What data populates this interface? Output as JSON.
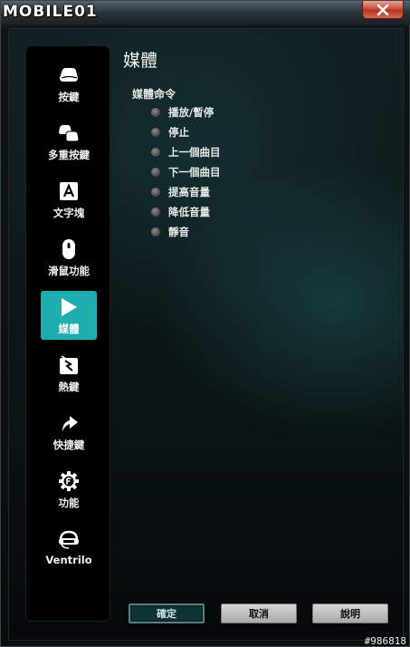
{
  "watermark": {
    "logo": "MOBILE01",
    "id": "#986818"
  },
  "window": {
    "close_symbol": "✕"
  },
  "sidebar": {
    "items": [
      {
        "label": "按鍵",
        "icon": "key-icon"
      },
      {
        "label": "多重按鍵",
        "icon": "multi-key-icon"
      },
      {
        "label": "文字塊",
        "icon": "text-block-icon"
      },
      {
        "label": "滑鼠功能",
        "icon": "mouse-icon"
      },
      {
        "label": "媒體",
        "icon": "play-icon",
        "active": true
      },
      {
        "label": "熱鍵",
        "icon": "hotkey-icon"
      },
      {
        "label": "快捷鍵",
        "icon": "shortcut-arrow-icon"
      },
      {
        "label": "功能",
        "icon": "function-gear-icon"
      },
      {
        "label": "Ventrilo",
        "icon": "headset-icon"
      }
    ]
  },
  "main": {
    "title": "媒體",
    "group_label": "媒體命令",
    "options": [
      "播放/暫停",
      "停止",
      "上一個曲目",
      "下一個曲目",
      "提高音量",
      "降低音量",
      "靜音"
    ]
  },
  "footer": {
    "ok": "確定",
    "cancel": "取消",
    "help": "說明"
  },
  "colors": {
    "accent": "#1faeb0",
    "close": "#c9503b"
  }
}
